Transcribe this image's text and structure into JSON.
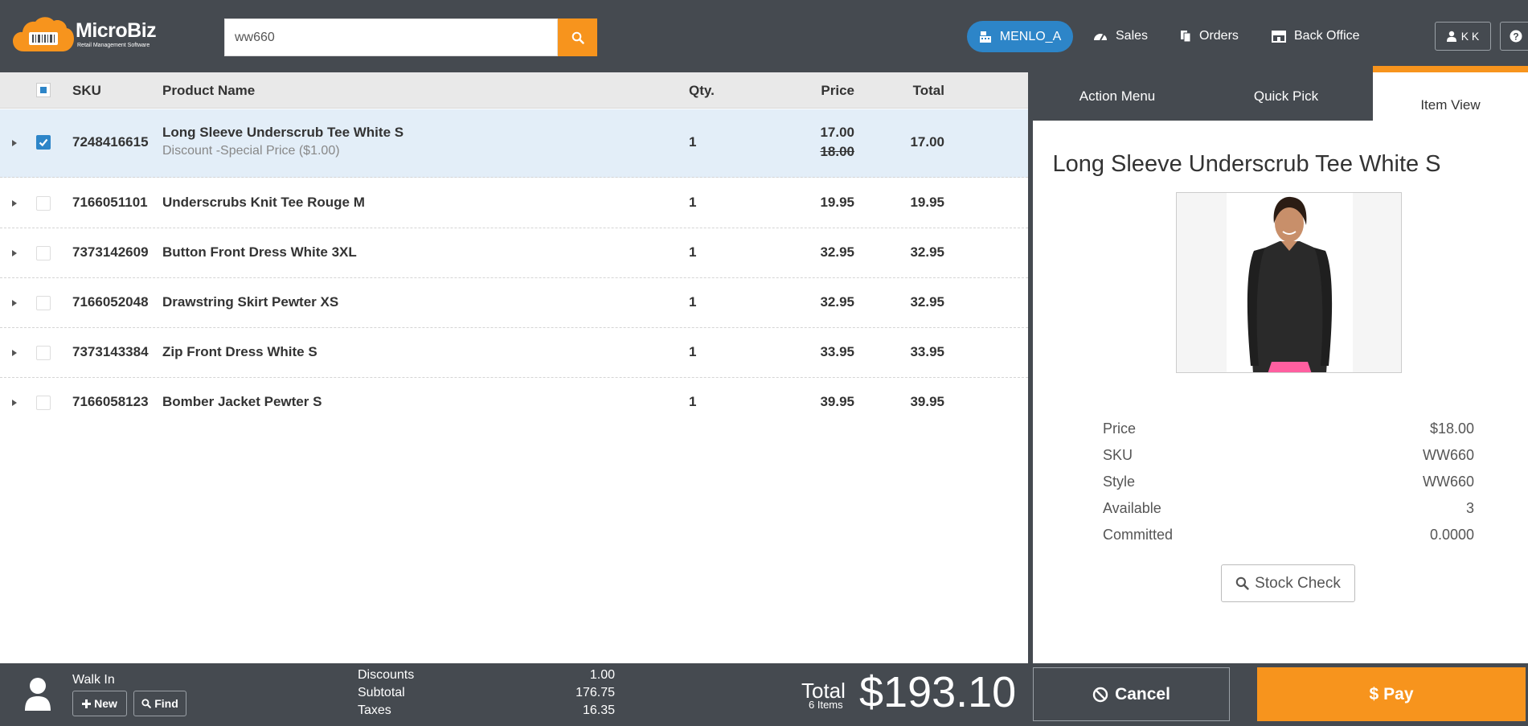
{
  "app": {
    "brand": "MicroBiz",
    "tagline": "Retail Management Software"
  },
  "search": {
    "value": "ww660"
  },
  "nav": {
    "store": "MENLO_A",
    "sales": "Sales",
    "orders": "Orders",
    "back_office": "Back Office",
    "user": "K K"
  },
  "table": {
    "headers": {
      "sku": "SKU",
      "name": "Product Name",
      "qty": "Qty.",
      "price": "Price",
      "total": "Total"
    },
    "rows": [
      {
        "sku": "7248416615",
        "name": "Long Sleeve Underscrub Tee White S",
        "discount": "Discount -Special Price ($1.00)",
        "qty": "1",
        "price": "17.00",
        "original_price": "18.00",
        "total": "17.00",
        "checked": true
      },
      {
        "sku": "7166051101",
        "name": "Underscrubs Knit Tee Rouge M",
        "qty": "1",
        "price": "19.95",
        "total": "19.95",
        "checked": false
      },
      {
        "sku": "7373142609",
        "name": "Button Front Dress White 3XL",
        "qty": "1",
        "price": "32.95",
        "total": "32.95",
        "checked": false
      },
      {
        "sku": "7166052048",
        "name": "Drawstring Skirt Pewter XS",
        "qty": "1",
        "price": "32.95",
        "total": "32.95",
        "checked": false
      },
      {
        "sku": "7373143384",
        "name": "Zip Front Dress White S",
        "qty": "1",
        "price": "33.95",
        "total": "33.95",
        "checked": false
      },
      {
        "sku": "7166058123",
        "name": "Bomber Jacket Pewter S",
        "qty": "1",
        "price": "39.95",
        "total": "39.95",
        "checked": false
      }
    ]
  },
  "panel": {
    "tabs": {
      "action_menu": "Action Menu",
      "quick_pick": "Quick Pick",
      "item_view": "Item View"
    },
    "item": {
      "title": "Long Sleeve Underscrub Tee White S",
      "details": [
        {
          "label": "Price",
          "value": "$18.00"
        },
        {
          "label": "SKU",
          "value": "WW660"
        },
        {
          "label": "Style",
          "value": "WW660"
        },
        {
          "label": "Available",
          "value": "3"
        },
        {
          "label": "Committed",
          "value": "0.0000"
        }
      ],
      "stock_check": "Stock Check"
    }
  },
  "footer": {
    "customer": "Walk In",
    "new_label": "New",
    "find_label": "Find",
    "discounts_label": "Discounts",
    "discounts_value": "1.00",
    "subtotal_label": "Subtotal",
    "subtotal_value": "176.75",
    "taxes_label": "Taxes",
    "taxes_value": "16.35",
    "total_label": "Total",
    "items_count": "6 Items",
    "total_amount": "$193.10",
    "cancel_label": "Cancel",
    "pay_label": "Pay"
  },
  "colors": {
    "topbar": "#454a50",
    "accent_orange": "#f7941d",
    "accent_blue": "#2d85c8",
    "selected_row": "#e3eef8"
  }
}
